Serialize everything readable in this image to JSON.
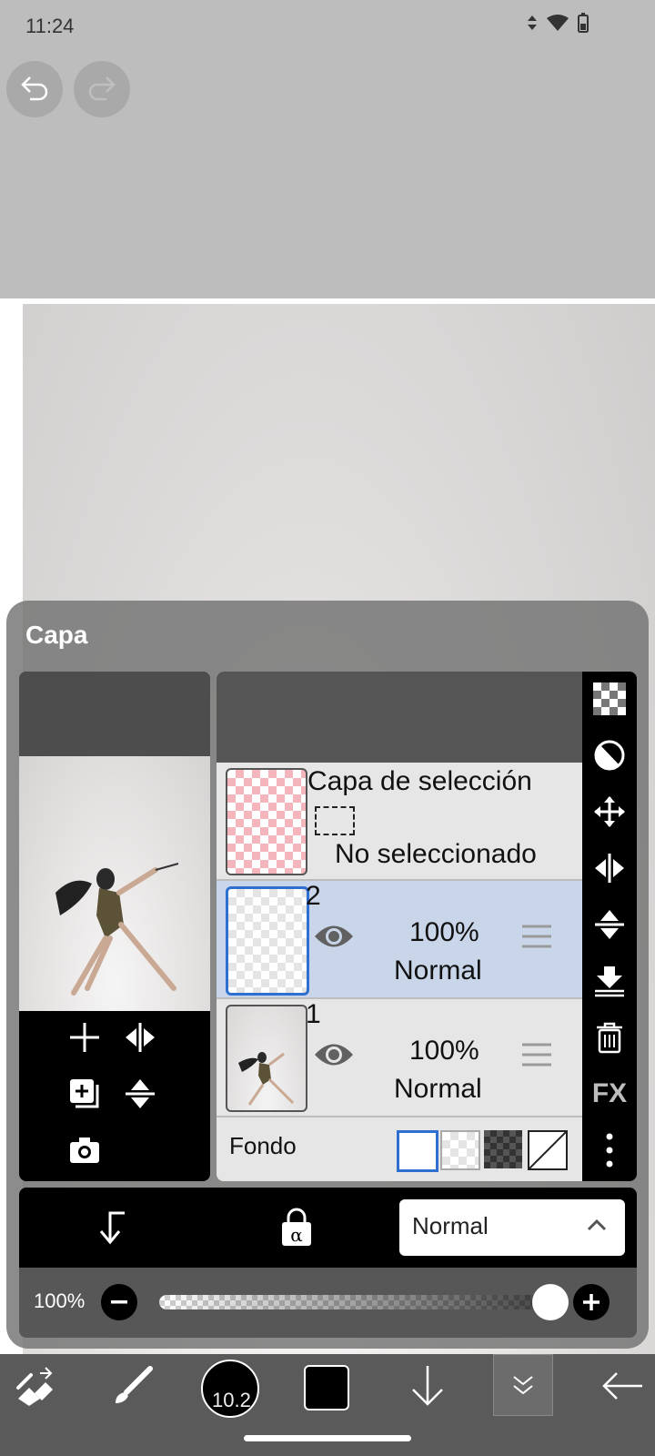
{
  "status_bar": {
    "time": "11:24"
  },
  "panel": {
    "title": "Capa"
  },
  "layers": {
    "selection_layer": {
      "name": "Capa de selección",
      "status": "No seleccionado"
    },
    "items": [
      {
        "name": "2",
        "opacity": "100%",
        "blend": "Normal",
        "selected": true
      },
      {
        "name": "1",
        "opacity": "100%",
        "blend": "Normal",
        "selected": false
      }
    ],
    "background_label": "Fondo"
  },
  "blend_select": {
    "value": "Normal"
  },
  "opacity_slider": {
    "label": "100%",
    "value": 1.0
  },
  "toolbar": {
    "brush_size": "10.2"
  },
  "right_tools": {
    "fx_label": "FX"
  },
  "colors": {
    "selected_layer_bg": "#c9d6ea",
    "accent_blue": "#2f6fd0",
    "panel_bg": "#737373"
  }
}
